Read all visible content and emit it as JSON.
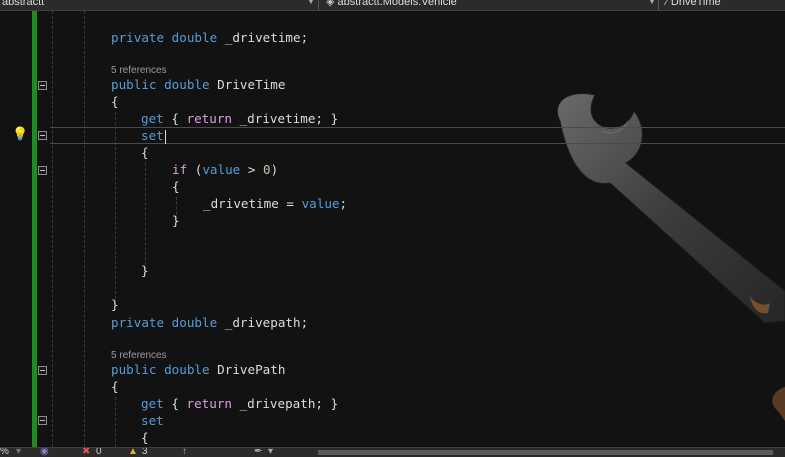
{
  "navbar": {
    "project": "abstractt",
    "class_scope": "abstractt.Models.Vehicle",
    "member_scope": "DriveTime"
  },
  "editor": {
    "lines": {
      "l1": {
        "kw1": "private",
        "kw2": "double",
        "id": " _drivetime;"
      },
      "l2_ref": "5 references",
      "l3": {
        "kw1": "public",
        "kw2": "double",
        "id": " DriveTime"
      },
      "l4": "{",
      "l5": {
        "kw": "get",
        "p1": " { ",
        "ctl": "return",
        "p2": " _drivetime; }"
      },
      "l6": {
        "kw": "set"
      },
      "l7": "{",
      "l8": {
        "ctl": "if",
        "p1": " (",
        "kw": "value",
        "p2": " > ",
        "num": "0",
        "p3": ")"
      },
      "l9": "{",
      "l10": {
        "p1": "_drivetime = ",
        "kw": "value",
        "p2": ";"
      },
      "l11": "}",
      "l12": "}",
      "l13": "}",
      "l14": {
        "kw1": "private",
        "kw2": "double",
        "id": " _drivepath;"
      },
      "l15_ref": "5 references",
      "l16": {
        "kw1": "public",
        "kw2": "double",
        "id": " DrivePath"
      },
      "l17": "{",
      "l18": {
        "kw": "get",
        "p1": " { ",
        "ctl": "return",
        "p2": " _drivepath; }"
      },
      "l19": {
        "kw": "set"
      },
      "l20": "{"
    }
  },
  "statusbar": {
    "zoom": "%",
    "errors": "0",
    "warnings": "3"
  },
  "colors": {
    "keyword": "#569cd6",
    "control": "#d8a0df",
    "number": "#b5cea8",
    "identifier": "#dcdcdc",
    "change_bar": "#1f8c1f",
    "background": "#121212"
  },
  "icons": [
    "lightbulb-icon",
    "collapse-icon",
    "cube-icon",
    "error-icon",
    "warning-icon",
    "arrow-up-icon",
    "brush-icon",
    "wrench-image"
  ]
}
